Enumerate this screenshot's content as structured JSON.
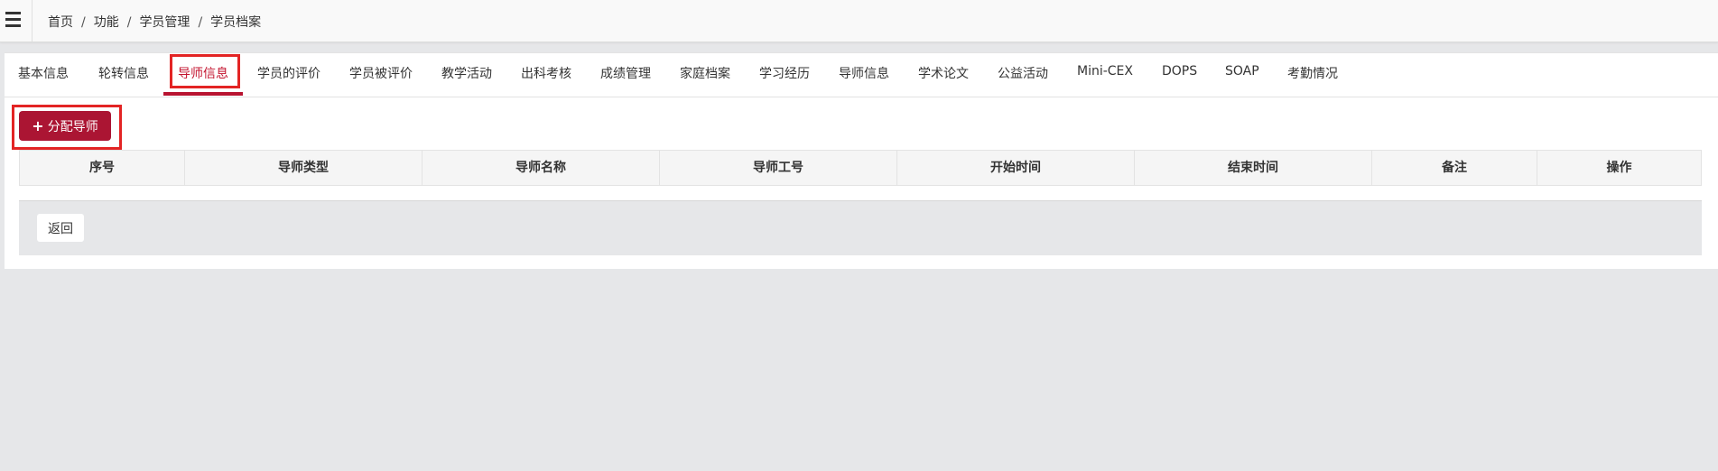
{
  "breadcrumb": [
    "首页",
    "功能",
    "学员管理",
    "学员档案"
  ],
  "tabs": [
    {
      "label": "基本信息"
    },
    {
      "label": "轮转信息"
    },
    {
      "label": "导师信息",
      "active": true
    },
    {
      "label": "学员的评价"
    },
    {
      "label": "学员被评价"
    },
    {
      "label": "教学活动"
    },
    {
      "label": "出科考核"
    },
    {
      "label": "成绩管理"
    },
    {
      "label": "家庭档案"
    },
    {
      "label": "学习经历"
    },
    {
      "label": "导师信息"
    },
    {
      "label": "学术论文"
    },
    {
      "label": "公益活动"
    },
    {
      "label": "Mini-CEX"
    },
    {
      "label": "DOPS"
    },
    {
      "label": "SOAP"
    },
    {
      "label": "考勤情况"
    }
  ],
  "actions": {
    "assign_label": "分配导师",
    "assign_icon": "plus-icon"
  },
  "table": {
    "columns": [
      "序号",
      "导师类型",
      "导师名称",
      "导师工号",
      "开始时间",
      "结束时间",
      "备注",
      "操作"
    ],
    "rows": []
  },
  "footer": {
    "back_label": "返回"
  },
  "colors": {
    "accent": "#ab1533",
    "highlight": "#e32424",
    "background": "#e6e7e9"
  }
}
